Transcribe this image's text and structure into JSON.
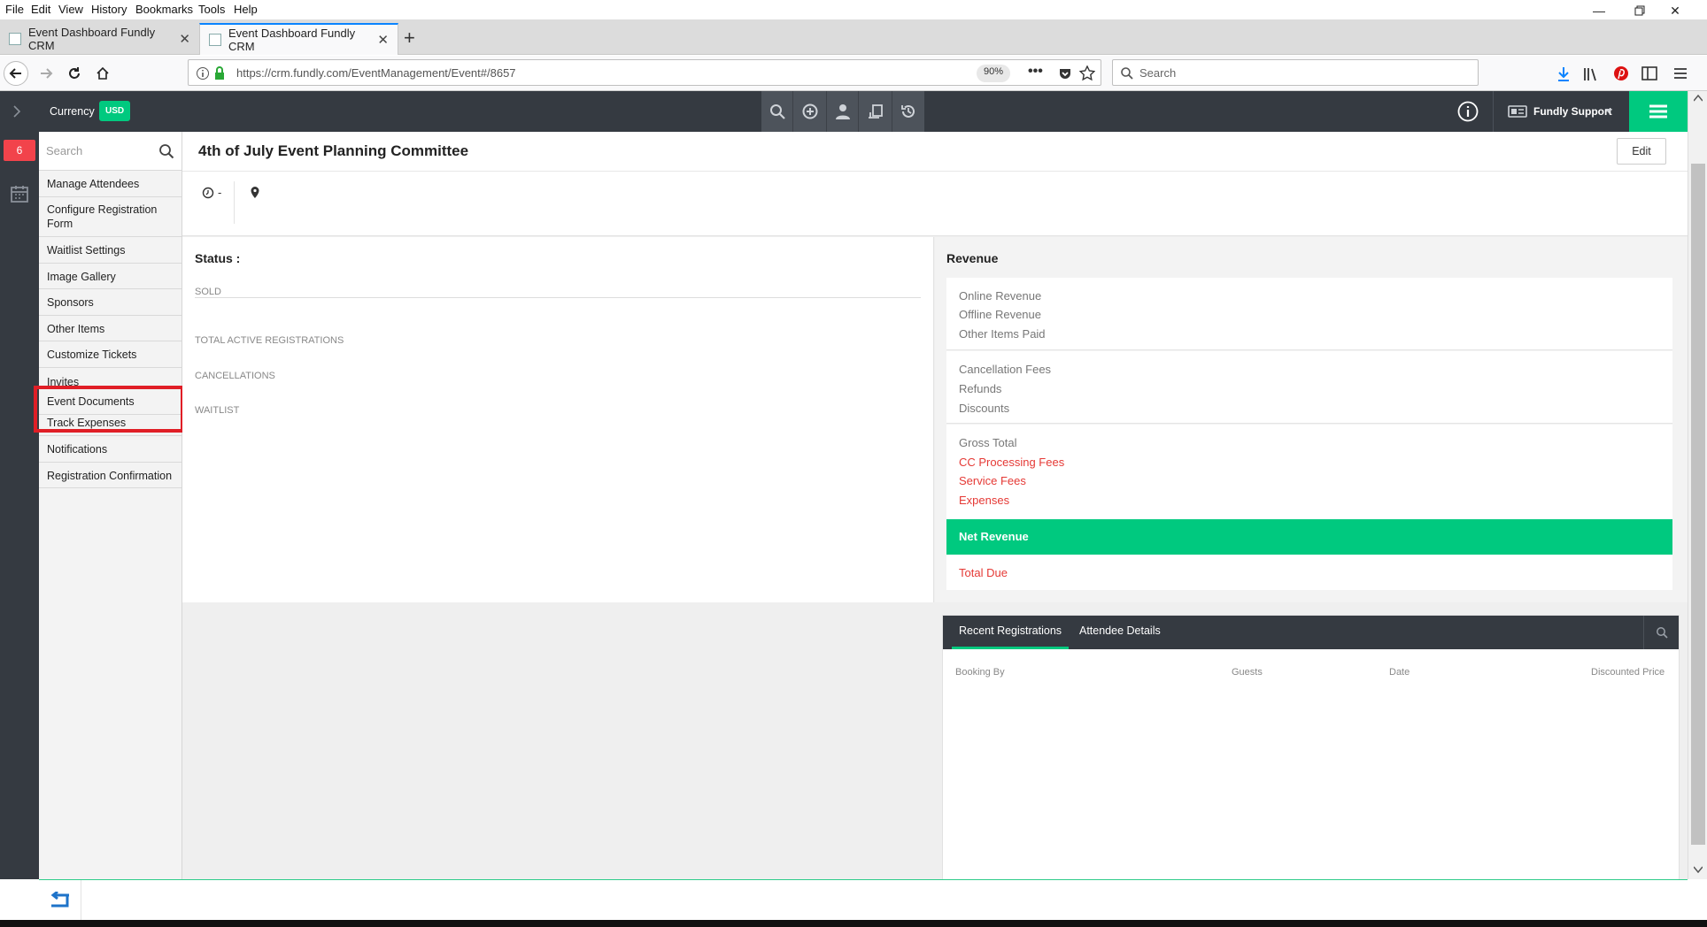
{
  "menubar": {
    "items": [
      "File",
      "Edit",
      "View",
      "History",
      "Bookmarks",
      "Tools",
      "Help"
    ]
  },
  "tabs": [
    {
      "title": "Event Dashboard Fundly CRM"
    },
    {
      "title": "Event Dashboard Fundly CRM"
    }
  ],
  "navbar": {
    "url": "https://crm.fundly.com/EventManagement/Event#/8657",
    "zoom": "90%",
    "search_placeholder": "Search"
  },
  "app": {
    "currency_label": "Currency",
    "currency_value": "USD",
    "user_name": "Fundly Support",
    "notification_count": "6"
  },
  "sidebar": {
    "search_placeholder": "Search",
    "items": [
      "Manage Attendees",
      "Configure Registration Form",
      "Waitlist Settings",
      "Image Gallery",
      "Sponsors",
      "Other Items",
      "Customize Tickets",
      "Invites",
      "Event Documents",
      "Track Expenses",
      "Notifications",
      "Registration Confirmation"
    ]
  },
  "event": {
    "title": "4th of July Event Planning Committee",
    "edit_label": "Edit",
    "time_value": "-"
  },
  "status": {
    "heading": "Status :",
    "sold": "SOLD",
    "total_active": "TOTAL ACTIVE REGISTRATIONS",
    "cancellations": "CANCELLATIONS",
    "waitlist": "WAITLIST"
  },
  "revenue": {
    "heading": "Revenue",
    "online": "Online Revenue",
    "offline": "Offline Revenue",
    "other_items": "Other Items Paid",
    "cancellation_fees": "Cancellation Fees",
    "refunds": "Refunds",
    "discounts": "Discounts",
    "gross_total": "Gross Total",
    "cc_fees": "CC Processing Fees",
    "service_fees": "Service Fees",
    "expenses": "Expenses",
    "net_revenue": "Net Revenue",
    "total_due": "Total Due"
  },
  "registrations": {
    "tab_recent": "Recent Registrations",
    "tab_attendee": "Attendee Details",
    "col_booking": "Booking By",
    "col_guests": "Guests",
    "col_date": "Date",
    "col_price": "Discounted Price"
  },
  "colors": {
    "accent_green": "#00c97f",
    "dark_bar": "#353a41",
    "highlight_red": "#e01e26",
    "negative_red": "#e53935"
  }
}
